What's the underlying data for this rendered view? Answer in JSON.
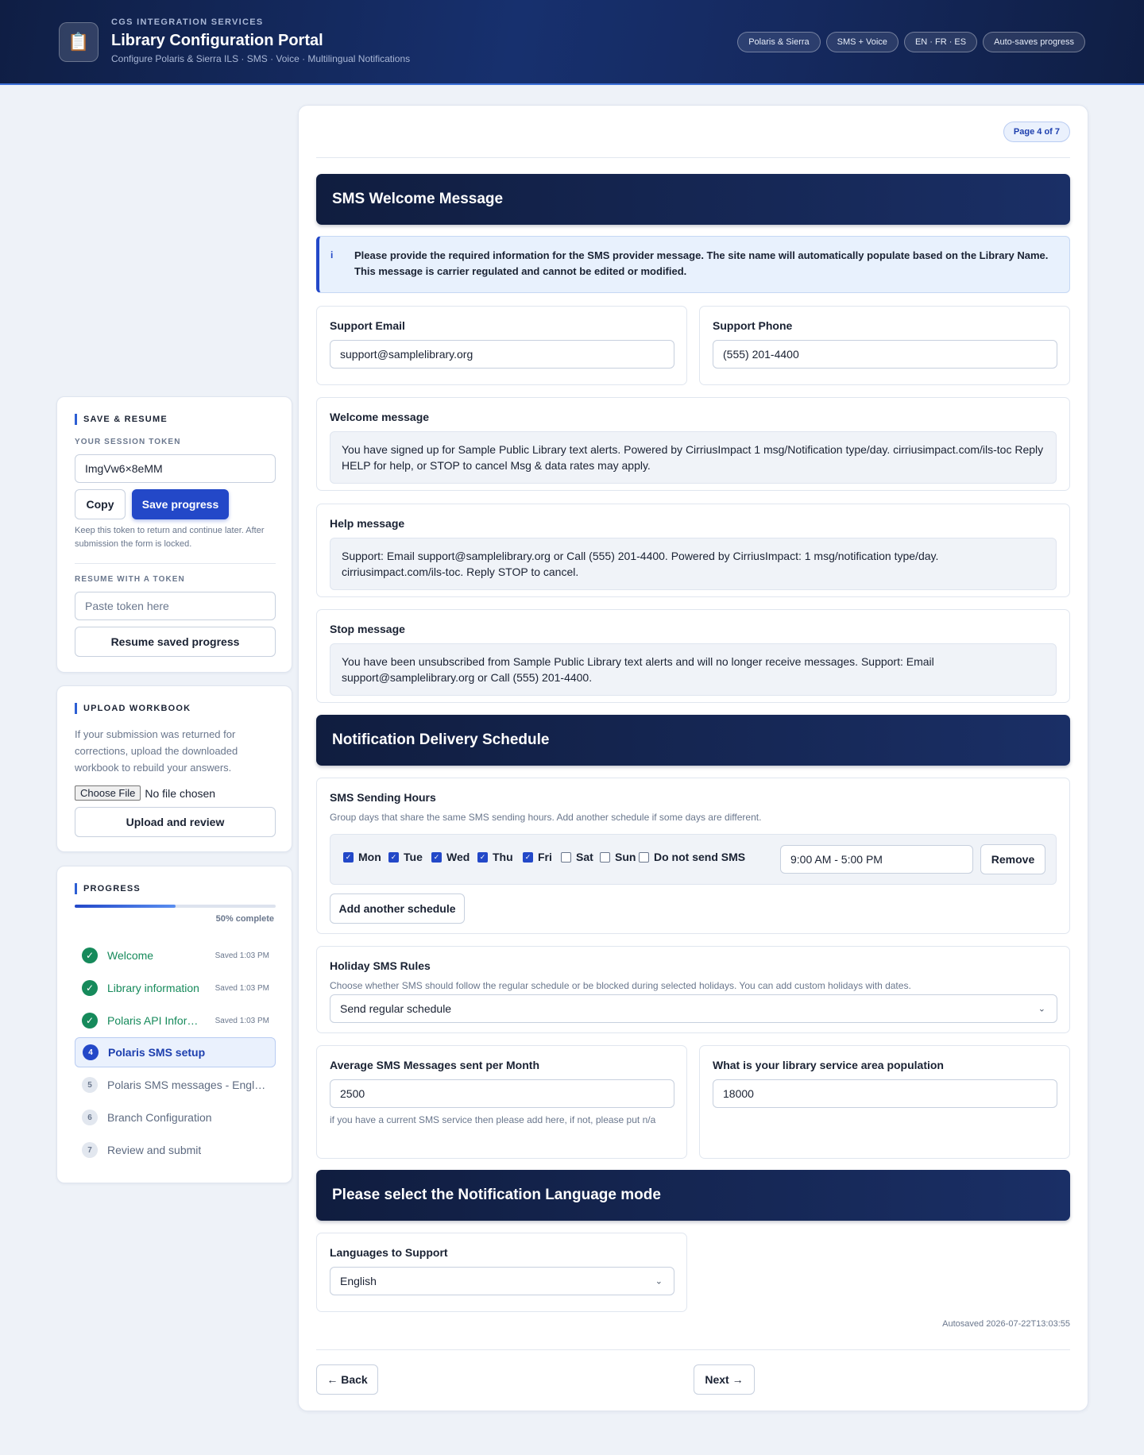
{
  "header": {
    "eyebrow": "CGS INTEGRATION SERVICES",
    "title": "Library Configuration Portal",
    "subtitle": "Configure Polaris & Sierra ILS · SMS · Voice · Multilingual Notifications",
    "logo_icon": "clipboard-icon",
    "pills": [
      "Polaris & Sierra",
      "SMS + Voice",
      "EN · FR · ES",
      "Auto-saves progress"
    ]
  },
  "save_resume": {
    "title": "SAVE & RESUME",
    "token_label": "YOUR SESSION TOKEN",
    "token_value": "ImgVw6×8eMM",
    "copy_label": "Copy",
    "save_label": "Save progress",
    "note": "Keep this token to return and continue later. After submission the form is locked.",
    "resume_label": "RESUME WITH A TOKEN",
    "resume_placeholder": "Paste token here",
    "resume_button": "Resume saved progress"
  },
  "upload": {
    "title": "UPLOAD WORKBOOK",
    "description": "If your submission was returned for corrections, upload the downloaded workbook to rebuild your answers.",
    "choose_file": "Choose File",
    "no_file": "No file chosen",
    "button": "Upload and review"
  },
  "progress": {
    "title": "PROGRESS",
    "percent": 0.5,
    "label": "50% complete",
    "steps": [
      {
        "num": "1",
        "label": "Welcome",
        "saved": "Saved 1:03 PM",
        "state": "done"
      },
      {
        "num": "2",
        "label": "Library information",
        "saved": "Saved 1:03 PM",
        "state": "done"
      },
      {
        "num": "3",
        "label": "Polaris API Information",
        "saved": "Saved 1:03 PM",
        "state": "done"
      },
      {
        "num": "4",
        "label": "Polaris SMS setup",
        "saved": "",
        "state": "active"
      },
      {
        "num": "5",
        "label": "Polaris SMS messages - English",
        "saved": "",
        "state": "todo"
      },
      {
        "num": "6",
        "label": "Branch Configuration",
        "saved": "",
        "state": "todo"
      },
      {
        "num": "7",
        "label": "Review and submit",
        "saved": "",
        "state": "todo"
      }
    ]
  },
  "main": {
    "page_badge": "Page 4 of 7",
    "sms_section": {
      "title": "SMS Welcome Message",
      "info_icon": "i",
      "info": "Please provide the required information for the SMS provider message. The site name will automatically populate based on the Library Name. This message is carrier regulated and cannot be edited or modified.",
      "support_email_label": "Support Email",
      "support_email_value": "support@samplelibrary.org",
      "support_phone_label": "Support Phone",
      "support_phone_value": "(555) 201-4400",
      "welcome_label": "Welcome message",
      "welcome_text": "You have signed up for Sample Public Library text alerts. Powered by CirriusImpact 1 msg/Notification type/day. cirriusimpact.com/ils-toc Reply HELP for help, or STOP to cancel Msg & data rates may apply.",
      "help_label": "Help message",
      "help_text": "Support: Email support@samplelibrary.org or Call (555) 201-4400. Powered by CirriusImpact: 1 msg/notification type/day. cirriusimpact.com/ils-toc. Reply STOP to cancel.",
      "stop_label": "Stop message",
      "stop_text": "You have been unsubscribed from Sample Public Library text alerts and will no longer receive messages. Support: Email support@samplelibrary.org or Call (555) 201-4400."
    },
    "schedule_section": {
      "title": "Notification Delivery Schedule",
      "hours_label": "SMS Sending Hours",
      "hours_help": "Group days that share the same SMS sending hours. Add another schedule if some days are different.",
      "days": [
        {
          "label": "Mon",
          "checked": true
        },
        {
          "label": "Tue",
          "checked": true
        },
        {
          "label": "Wed",
          "checked": true
        },
        {
          "label": "Thu",
          "checked": true
        },
        {
          "label": "Fri",
          "checked": true
        },
        {
          "label": "Sat",
          "checked": false
        },
        {
          "label": "Sun",
          "checked": false
        }
      ],
      "no_sms_label": "Do not send SMS",
      "hours_value": "9:00 AM - 5:00 PM",
      "remove_label": "Remove",
      "add_label": "Add another schedule",
      "holiday_label": "Holiday SMS Rules",
      "holiday_help": "Choose whether SMS should follow the regular schedule or be blocked during selected holidays. You can add custom holidays with dates.",
      "holiday_value": "Send regular schedule",
      "avg_label": "Average SMS Messages sent per Month",
      "avg_value": "2500",
      "avg_help": "if you have a current SMS service then please add here, if not, please put n/a",
      "pop_label": "What is your library service area population",
      "pop_value": "18000"
    },
    "language_section": {
      "title": "Please select the Notification Language mode",
      "label": "Languages to Support",
      "value": "English"
    },
    "autosaved": "Autosaved 2026-07-22T13:03:55",
    "back_label": "← Back",
    "next_label": "Next →"
  }
}
